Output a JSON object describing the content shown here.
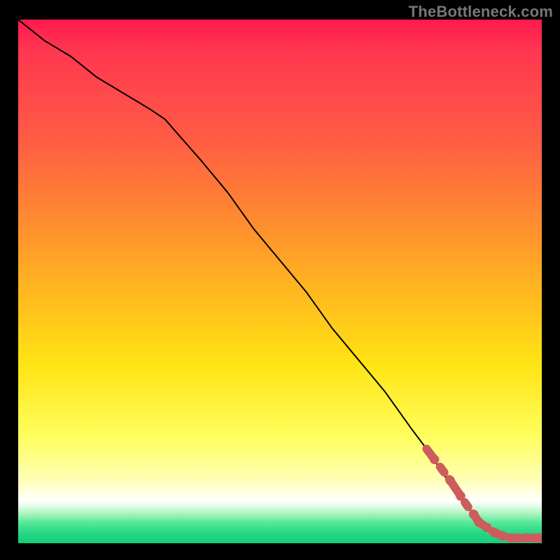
{
  "attribution": "TheBottleneck.com",
  "chart_data": {
    "type": "line",
    "title": "",
    "xlabel": "",
    "ylabel": "",
    "xlim": [
      0,
      100
    ],
    "ylim": [
      0,
      100
    ],
    "series": [
      {
        "name": "curve",
        "x": [
          0,
          5,
          10,
          15,
          20,
          25,
          28,
          35,
          40,
          45,
          50,
          55,
          60,
          65,
          70,
          75,
          78,
          82,
          85,
          88,
          91,
          94,
          97,
          100
        ],
        "y": [
          100,
          96,
          93,
          89,
          86,
          83,
          81,
          73,
          67,
          60,
          54,
          48,
          41,
          35,
          29,
          22,
          18,
          12,
          8,
          4,
          2,
          1,
          1,
          1
        ]
      }
    ],
    "highlight": {
      "name": "bottleneck-zone",
      "color": "#cd5c5c",
      "points_x": [
        78,
        79.5,
        81,
        82.5,
        83.5,
        84.5,
        85.5,
        87,
        88,
        89.5,
        91,
        92.5,
        94,
        95.5,
        97,
        98.5,
        99.5
      ],
      "points_y": [
        18,
        16,
        14,
        12,
        10.5,
        9,
        7.5,
        5.5,
        4,
        3,
        2,
        1.4,
        1,
        1,
        1,
        1,
        1
      ]
    },
    "background_gradient": {
      "top": "#ff1a4d",
      "mid1": "#ff8a30",
      "mid2": "#ffe414",
      "pale": "#ffffb8",
      "white": "#ffffff",
      "green": "#14cf78"
    }
  }
}
